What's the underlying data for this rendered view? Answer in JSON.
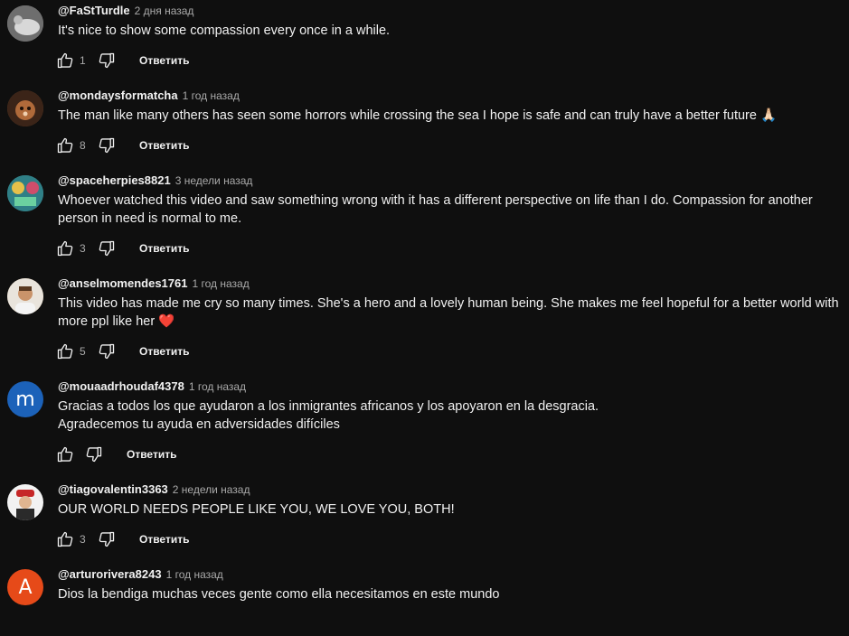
{
  "reply_label": "Ответить",
  "comments": [
    {
      "author": "@FaStTurdle",
      "time": "2 дня назад",
      "lines": [
        "It's nice to show some compassion every once in a while."
      ],
      "likes": "1",
      "avatar_color": "#9a9a9a",
      "avatar_letter": ""
    },
    {
      "author": "@mondaysformatcha",
      "time": "1 год назад",
      "lines": [
        "The man like many others has seen some horrors while crossing the sea I hope is safe and can truly have a better future 🙏🏻"
      ],
      "likes": "8",
      "avatar_color": "#7a4a2a",
      "avatar_letter": ""
    },
    {
      "author": "@spaceherpies8821",
      "time": "3 недели назад",
      "lines": [
        "Whoever watched this video and saw something wrong with it has a different perspective on life than I do. Compassion for another person in need is normal to me."
      ],
      "likes": "3",
      "avatar_color": "#4aa0a8",
      "avatar_letter": ""
    },
    {
      "author": "@anselmomendes1761",
      "time": "1 год назад",
      "lines": [
        "This video has made me cry so many times. She's a hero and a lovely human being. She makes me feel hopeful for a better world with more ppl like her ❤️"
      ],
      "likes": "5",
      "avatar_color": "#c8a070",
      "avatar_letter": ""
    },
    {
      "author": "@mouaadrhoudaf4378",
      "time": "1 год назад",
      "lines": [
        "Gracias a todos los que ayudaron a los inmigrantes africanos y los apoyaron en la desgracia.",
        "Agradecemos tu ayuda en adversidades difíciles"
      ],
      "likes": "",
      "avatar_color": "#1c62b9",
      "avatar_letter": "m"
    },
    {
      "author": "@tiagovalentin3363",
      "time": "2 недели назад",
      "lines": [
        "OUR WORLD NEEDS PEOPLE LIKE YOU, WE LOVE YOU, BOTH!"
      ],
      "likes": "3",
      "avatar_color": "#2a2a2a",
      "avatar_letter": ""
    },
    {
      "author": "@arturorivera8243",
      "time": "1 год назад",
      "lines": [
        "Dios  la bendiga  muchas veces gente como ella necesitamos en este mundo"
      ],
      "likes": "",
      "avatar_color": "#e64a19",
      "avatar_letter": "A"
    }
  ]
}
